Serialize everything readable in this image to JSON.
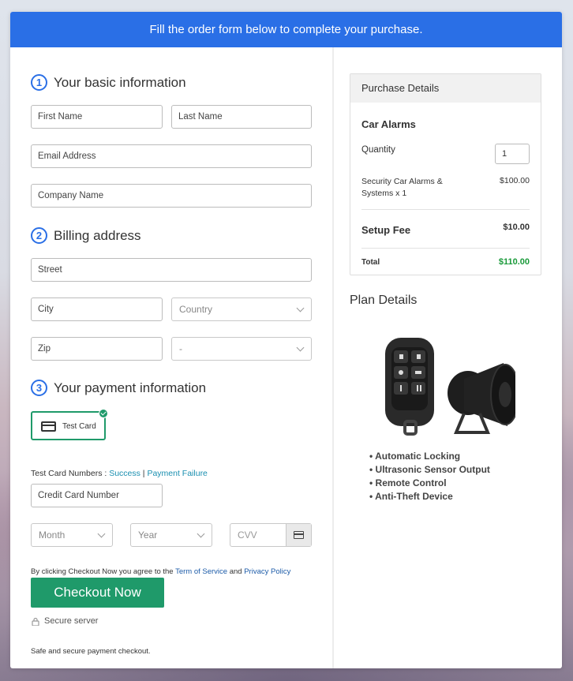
{
  "banner": {
    "text": "Fill the order form below to complete your purchase."
  },
  "sections": {
    "basic": {
      "num": "1",
      "title": "Your basic information"
    },
    "billing": {
      "num": "2",
      "title": "Billing address"
    },
    "payment": {
      "num": "3",
      "title": "Your payment information"
    }
  },
  "fields": {
    "first_name": "First Name",
    "last_name": "Last Name",
    "email": "Email Address",
    "company": "Company Name",
    "street": "Street",
    "city": "City",
    "country": "Country",
    "zip": "Zip",
    "state": "-",
    "card_number": "Credit Card Number",
    "month": "Month",
    "year": "Year",
    "cvv": "CVV"
  },
  "payment": {
    "test_card_label": "Test Card",
    "test_numbers_label": "Test Card Numbers : ",
    "success_link": "Success",
    "separator": " | ",
    "failure_link": "Payment Failure"
  },
  "terms": {
    "prefix": "By clicking Checkout Now you agree to the ",
    "tos_link": "Term of Service",
    "and": " and ",
    "privacy_link": "Privacy Policy"
  },
  "checkout": {
    "button_label": "Checkout Now",
    "secure_label": "Secure server",
    "note": "Safe and secure payment checkout."
  },
  "purchase": {
    "header": "Purchase Details",
    "product_title": "Car Alarms",
    "quantity_label": "Quantity",
    "quantity_value": "1",
    "item_name_line1": "Security Car Alarms &",
    "item_name_line2": "Systems x 1",
    "item_price": "$100.00",
    "setup_label": "Setup Fee",
    "setup_price": "$10.00",
    "total_label": "Total",
    "total_price": "$110.00"
  },
  "plan": {
    "title": "Plan Details",
    "features": [
      "Automatic Locking",
      "Ultrasonic Sensor Output",
      "Remote Control",
      "Anti-Theft Device"
    ]
  },
  "colors": {
    "accent": "#2a6fe6",
    "success": "#1f9a6a",
    "link": "#1a8fb0",
    "total": "#1a9a3a"
  }
}
